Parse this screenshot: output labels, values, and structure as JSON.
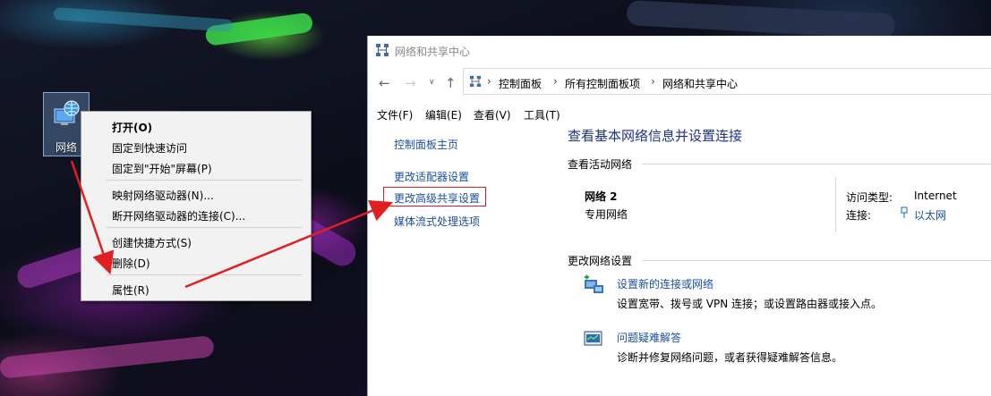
{
  "desktop": {
    "icon_label": "网络",
    "icon": "network-computer-icon"
  },
  "context_menu": {
    "items": [
      "打开(O)",
      "固定到快速访问",
      "固定到\"开始\"屏幕(P)",
      "映射网络驱动器(N)...",
      "断开网络驱动器的连接(C)...",
      "创建快捷方式(S)",
      "删除(D)",
      "属性(R)"
    ],
    "bold_item": "打开(O)"
  },
  "window": {
    "title": "网络和共享中心",
    "breadcrumbs": [
      "控制面板",
      "所有控制面板项",
      "网络和共享中心"
    ],
    "menus": [
      "文件(F)",
      "编辑(E)",
      "查看(V)",
      "工具(T)"
    ],
    "left_links": [
      "控制面板主页",
      "更改适配器设置",
      "更改高级共享设置",
      "媒体流式处理选项"
    ],
    "highlighted_link": "更改高级共享设置",
    "main": {
      "heading": "查看基本网络信息并设置连接",
      "active_networks_label": "查看活动网络",
      "network_name": "网络 2",
      "network_type": "专用网络",
      "access_type_label": "访问类型:",
      "access_type_value": "Internet",
      "connection_label": "连接:",
      "connection_value": "以太网",
      "change_settings_label": "更改网络设置",
      "task1_link": "设置新的连接或网络",
      "task1_desc": "设置宽带、拨号或 VPN 连接；或设置路由器或接入点。",
      "task2_link": "问题疑难解答",
      "task2_desc": "诊断并修复网络问题，或者获得疑难解答信息。"
    }
  },
  "colors": {
    "accent_link": "#1a4fa0",
    "heading": "#1e3287",
    "annotation_red": "#e02020"
  }
}
